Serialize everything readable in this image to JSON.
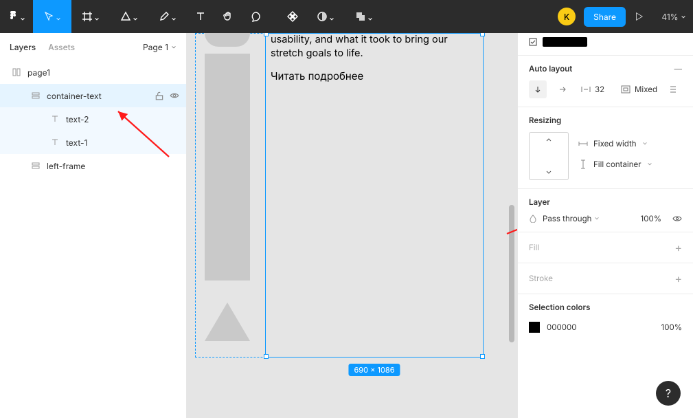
{
  "toolbar": {
    "avatar": "K",
    "share": "Share",
    "zoom": "41%"
  },
  "left": {
    "tab_layers": "Layers",
    "tab_assets": "Assets",
    "page_picker": "Page 1",
    "rows": {
      "page": "page1",
      "container": "container-text",
      "t2": "text-2",
      "t1": "text-1",
      "lf": "left-frame"
    }
  },
  "canvas": {
    "body": "usability, and what it took to bring our stretch goals to life.",
    "link": "Читать подробнее",
    "dims": "690 × 1086"
  },
  "right": {
    "auto_layout": "Auto layout",
    "spacing": "32",
    "padding": "Mixed",
    "resizing": "Resizing",
    "width_mode": "Fixed width",
    "height_mode": "Fill container",
    "layer": "Layer",
    "blend": "Pass through",
    "opacity": "100%",
    "fill": "Fill",
    "stroke": "Stroke",
    "sel_colors": "Selection colors",
    "sc_hex": "000000",
    "sc_pct": "100%"
  },
  "help": "?"
}
